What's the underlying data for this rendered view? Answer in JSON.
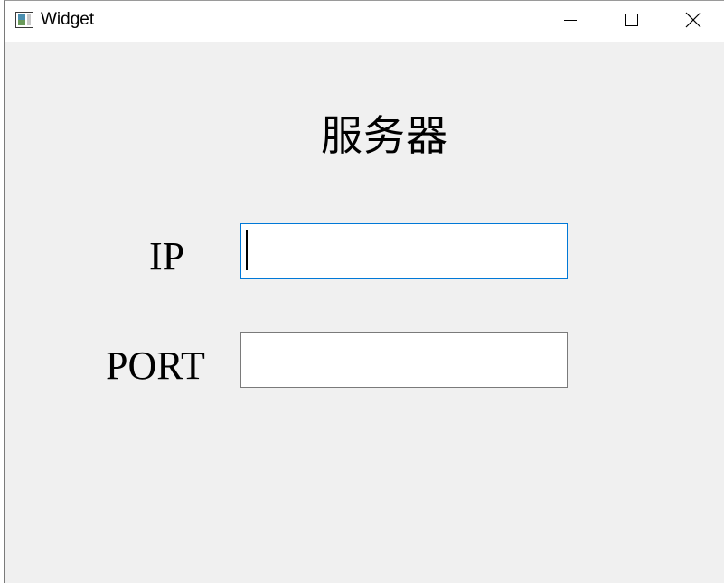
{
  "window": {
    "title": "Widget",
    "controls": {
      "minimize_icon": "minimize-icon",
      "maximize_icon": "maximize-icon",
      "close_icon": "close-icon"
    }
  },
  "form": {
    "heading": "服务器",
    "ip_label": "IP",
    "ip_value": "",
    "port_label": "PORT",
    "port_value": ""
  },
  "colors": {
    "focus_border": "#0078d7",
    "background": "#f0f0f0"
  }
}
